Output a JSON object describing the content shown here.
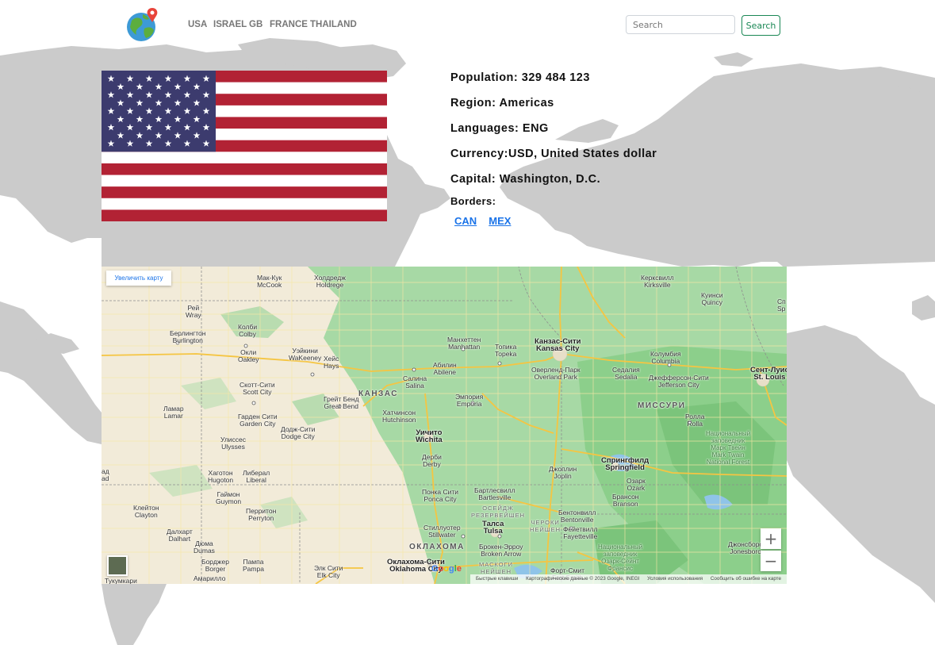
{
  "nav": {
    "links": [
      "USA",
      "ISRAEL",
      "GB",
      "FRANCE",
      "THAILAND"
    ],
    "search_placeholder": "Search",
    "search_button": "Search"
  },
  "country": {
    "population": "Population: 329 484 123",
    "region": "Region: Americas",
    "languages": "Languages: ENG",
    "currency": "Currency:USD, United States dollar",
    "capital": "Capital: Washington, D.C.",
    "borders_label": "Borders:",
    "borders": [
      "CAN",
      "MEX"
    ]
  },
  "flag": {
    "colors": {
      "red": "#b22234",
      "white": "#ffffff",
      "blue": "#3c3b6e"
    }
  },
  "map": {
    "enlarge_label": "Увеличить карту",
    "zoom_in": "+",
    "zoom_out": "−",
    "google_logo": "Google",
    "footer": {
      "shortcuts": "Быстрые клавиши",
      "data": "Картографические данные © 2023 Google, INEGI",
      "terms": "Условия использования",
      "report": "Сообщить об ошибке на карте"
    },
    "labels": {
      "reywray": "Рей\nWray",
      "mccook": "Мак-Кук\nMcCook",
      "holdrege": "Холдредж\nHoldrege",
      "kirksville": "Керксвилл\nKirksville",
      "quincy": "Куинси\nQuincy",
      "burlington": "Берлингтон\nBurlington",
      "colby": "Колби\nColby",
      "oakley": "Окли\nOakley",
      "wakeeney": "Уэйкини\nWaKeeney",
      "hays": "Хейс\nHays",
      "manhattan": "Манхеттен\nManhattan",
      "topeka": "Топика\nTopeka",
      "kansascity": "Канзас-Сити\nKansas City",
      "columbia": "Колумбия\nColumbia",
      "stlouis": "Сент-Луис\nSt. Louis",
      "abilene": "Абилин\nAbilene",
      "overlandpark": "Оверленд-Парк\nOverland Park",
      "sedalia": "Седалия\nSedalia",
      "jeffersoncity": "Джефферсон-Сити\nJefferson City",
      "salina": "Салина\nSalina",
      "scottcity": "Скотт-Сити\nScott City",
      "greatbend": "Грейт Бенд\nGreat Bend",
      "emporia": "Эмпория\nEmporia",
      "kansas": "КАНЗАС",
      "lamar": "Ламар\nLamar",
      "hutchinson": "Хатчинсон\nHutchinson",
      "missouri": "МИССУРИ",
      "gardencity": "Гарден Сити\nGarden City",
      "dodgecity": "Додж-Сити\nDodge City",
      "rolla": "Ролла\nRolla",
      "wichita": "Уичито\nWichita",
      "ulysses": "Улиссес\nUlysses",
      "marktwain": "Национальный\nзаповедник\nМарк Твейн\nMark Twain\nNational Forest",
      "derby": "Дерби\nDerby",
      "springfield": "Спрингфилд\nSpringfield",
      "hugoton": "Хаготон\nHugoton",
      "liberal": "Либерал\nLiberal",
      "joplin": "Джоплин\nJoplin",
      "ozark": "Озарк\nOzark",
      "guymon": "Гаймон\nGuymon",
      "poncacity": "Понка Сити\nPonca City",
      "bartlesville": "Бартлесвилл\nBartlesville",
      "osagereserve": "ОСЕЙДЖ\nРЕЗЕРВЕЙШЕН",
      "branson": "Брансон\nBranson",
      "clayton": "Клейтон\nClayton",
      "perryton": "Перритон\nPerryton",
      "bentonville": "Бентонвилл\nBentonville",
      "stillwater": "Стиллуотер\nStillwater",
      "tulsa": "Талса\nTulsa",
      "cherokeenation": "ЧЕРОКИ\nНЕЙШЕН",
      "fayetteville": "Фейетвилл\nFayetteville",
      "dalhart": "Далхарт\nDalhart",
      "dumas": "Дюма\nDumas",
      "oklahoma": "ОКЛАХОМА",
      "brokenarrow": "Брокен-Эрроу\nBroken Arrow",
      "ozarkforest": "Национальный\nзаповедник\nОзарк-Сейнт\nФрансис",
      "jonesboro": "Джонсборо\nJonesboro",
      "borger": "Борджер\nBorger",
      "pampa": "Пампа\nPampa",
      "okcity": "Оклахома-Сити\nOklahoma City",
      "muskogeenation": "МАСКОГИ\nНЕЙШЕН",
      "elkcity": "Элк Сити\nElk City",
      "fortsmith": "Форт-Смит\nFort Smith",
      "amarillo": "Амарилло",
      "tucumcari": "Тукумкари",
      "hada": "ад\nad",
      "stl_partial": "Сп\nSp"
    }
  }
}
